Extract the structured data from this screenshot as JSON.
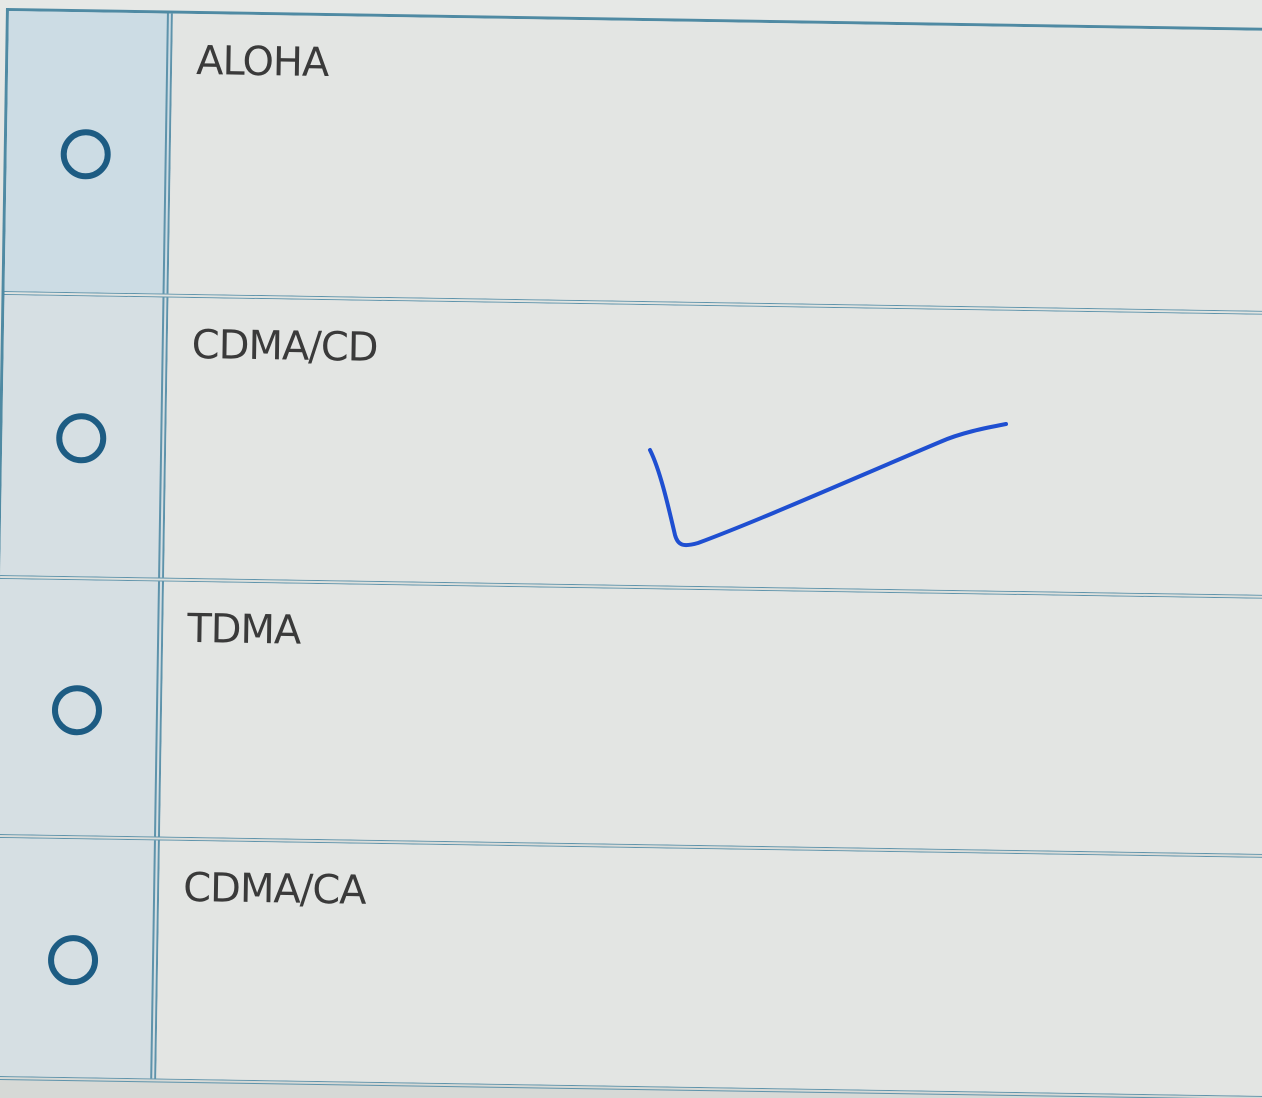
{
  "options": [
    {
      "label": "ALOHA",
      "selected": false
    },
    {
      "label": "CDMA/CD",
      "selected": false,
      "handwritten_check": true
    },
    {
      "label": "TDMA",
      "selected": false
    },
    {
      "label": "CDMA/CA",
      "selected": false
    }
  ],
  "colors": {
    "border": "#5e93ab",
    "radio": "#1d5c83",
    "check_ink": "#1f4fd1",
    "radio_column_bg": "#ccdce4"
  },
  "icons": {
    "radio": "radio-unselected-icon",
    "annotation": "handwritten-checkmark-icon"
  }
}
